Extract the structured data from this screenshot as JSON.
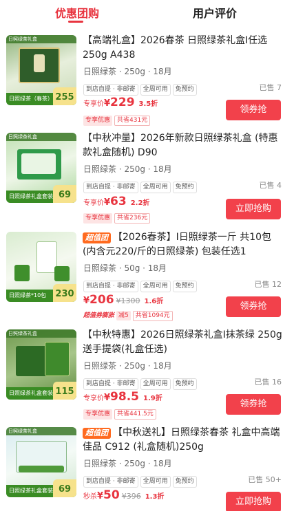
{
  "tabs": {
    "active": "优惠团购",
    "inactive": "用户评价"
  },
  "colors": {
    "accent": "#e8343f",
    "button": "#f2414b",
    "tea_green": "#3a8c24"
  },
  "products": [
    {
      "title": "【高端礼盒】2026春茶 日照绿茶礼盒I任选 250g A438",
      "hot": "",
      "spec": "日照绿茶 · 250g · 18月",
      "tags": [
        "到店自提 · 非邮寄",
        "全周可用",
        "免预约"
      ],
      "sold": "已售 7",
      "price_label": "专享价",
      "currency": "¥",
      "price": "229",
      "old_price": "",
      "discount": "3.5折",
      "promo": "专享优惠",
      "save": "共省431元",
      "button": "领券抢",
      "thumb": {
        "top": "日照绿茶礼盒",
        "bottom": "日照绿茶（春茶）礼盒",
        "price": "255"
      }
    },
    {
      "title": "【中秋冲量】2026年新款日照绿茶礼盒 (特惠款礼盒随机) D90",
      "hot": "",
      "spec": "日照绿茶 · 250g · 18月",
      "tags": [
        "到店自提 · 非邮寄",
        "全周可用",
        "免预约"
      ],
      "sold": "已售 4",
      "price_label": "专享价",
      "currency": "¥",
      "price": "63",
      "old_price": "",
      "discount": "2.2折",
      "promo": "专享优惠",
      "save": "共省236元",
      "button": "立即抢购",
      "thumb": {
        "top": "日照绿茶礼盒",
        "bottom": "日照绿茶礼盒套装",
        "price": "69"
      }
    },
    {
      "title": "【2026春茶】I日照绿茶一斤 共10包(内含元220/斤的日照绿茶) 包装任选1",
      "hot": "超值团",
      "spec": "日照绿茶 · 50g · 18月",
      "tags": [
        "到店自提 · 非邮寄",
        "全周可用",
        "免预约"
      ],
      "sold": "已售 12",
      "price_label": "",
      "currency": "¥",
      "price": "206",
      "old_price": "¥1300",
      "discount": "1.6折",
      "super": "超值券膨胀",
      "reduce": "减5",
      "save": "共省1094元",
      "button": "领券抢",
      "thumb": {
        "top": "",
        "bottom": "日照绿茶*10包",
        "price": "230"
      }
    },
    {
      "title": "【中秋特惠】2026日照绿茶礼盒I抹茶绿 250g送手提袋(礼盒任选)",
      "hot": "",
      "spec": "日照绿茶 · 250g · 18月",
      "tags": [
        "到店自提 · 非邮寄",
        "全周可用",
        "免预约"
      ],
      "sold": "已售 16",
      "price_label": "专享价",
      "currency": "¥",
      "price": "98.5",
      "old_price": "",
      "discount": "1.9折",
      "promo": "专享优惠",
      "save": "共省441.5元",
      "button": "领券抢",
      "thumb": {
        "top": "日照绿茶礼盒",
        "bottom": "日照绿茶礼盒套装",
        "price": "115"
      }
    },
    {
      "title": "【中秋送礼】日照绿茶春茶 礼盒中高端佳品 C912 (礼盒随机)250g",
      "hot": "超值团",
      "spec": "日照绿茶 · 250g · 18月",
      "tags": [
        "到店自提 · 非邮寄",
        "全周可用",
        "免预约"
      ],
      "sold": "已售 50+",
      "price_label": "秒杀",
      "currency": "¥",
      "price": "50",
      "old_price": "¥396",
      "discount": "1.3折",
      "button": "立即抢购",
      "thumb": {
        "top": "日照绿茶礼盒",
        "bottom": "日照绿茶礼盒套装",
        "price": "69"
      }
    }
  ]
}
